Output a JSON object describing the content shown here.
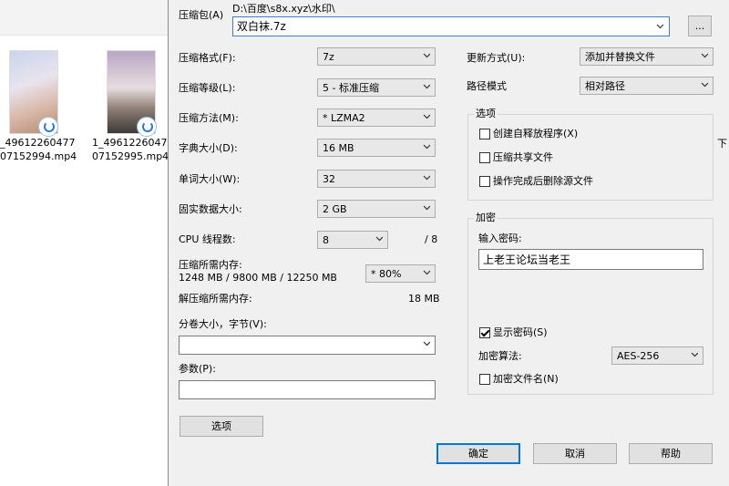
{
  "explorer": {
    "files": [
      {
        "name_line1": "_49612260477",
        "name_line2": "07152994.mp4"
      },
      {
        "name_line1": "1_49612260477",
        "name_line2": "07152995.mp4"
      }
    ],
    "right_fragment": "下"
  },
  "dialog": {
    "archive_label": "压缩包(A)",
    "archive_path": "D:\\百度\\s8x.xyz\\水印\\",
    "archive_name": "双白袜.7z",
    "browse_label": "...",
    "format_label": "压缩格式(F):",
    "format_value": "7z",
    "level_label": "压缩等级(L):",
    "level_value": "5 - 标准压缩",
    "method_label": "压缩方法(M):",
    "method_value": "* LZMA2",
    "dict_label": "字典大小(D):",
    "dict_value": "16 MB",
    "word_label": "单词大小(W):",
    "word_value": "32",
    "solid_label": "固实数据大小:",
    "solid_value": "2 GB",
    "cpu_label": "CPU 线程数:",
    "cpu_value": "8",
    "cpu_total": "/ 8",
    "mem_label": "压缩所需内存:",
    "mem_values": "1248 MB / 9800 MB / 12250 MB",
    "mem_percent": "* 80%",
    "decomp_label": "解压缩所需内存:",
    "decomp_value": "18 MB",
    "split_label": "分卷大小，字节(V):",
    "split_value": "",
    "params_label": "参数(P):",
    "params_value": "",
    "options_button": "选项",
    "update_label": "更新方式(U):",
    "update_value": "添加并替换文件",
    "path_label": "路径模式",
    "path_value": "相对路径",
    "options_group": {
      "title": "选项",
      "sfx": "创建自释放程序(X)",
      "shared": "压缩共享文件",
      "delete_after": "操作完成后删除源文件"
    },
    "encryption_group": {
      "title": "加密",
      "password_label": "输入密码:",
      "password_value": "上老王论坛当老王",
      "show_password": "显示密码(S)",
      "method_label": "加密算法:",
      "method_value": "AES-256",
      "encrypt_names": "加密文件名(N)"
    },
    "ok_button": "确定",
    "cancel_button": "取消",
    "help_button": "帮助"
  }
}
